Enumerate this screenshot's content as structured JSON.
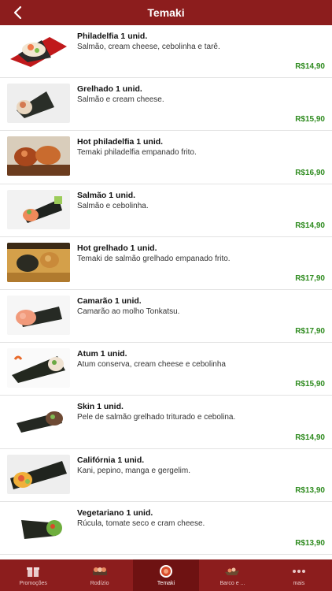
{
  "header": {
    "title": "Temaki",
    "back_icon": "chevron-left-icon"
  },
  "items": [
    {
      "name": "Philadelfia 1 unid.",
      "description": "Salmão, cream cheese, cebolinha e tarê.",
      "price": "R$14,90"
    },
    {
      "name": "Grelhado 1 unid.",
      "description": "Salmão e cream cheese.",
      "price": "R$15,90"
    },
    {
      "name": "Hot philadelfia 1 unid.",
      "description": "Temaki philadelfia empanado frito.",
      "price": "R$16,90"
    },
    {
      "name": "Salmão 1 unid.",
      "description": "Salmão e cebolinha.",
      "price": "R$14,90"
    },
    {
      "name": "Hot grelhado 1 unid.",
      "description": "Temaki de salmão grelhado empanado frito.",
      "price": "R$17,90"
    },
    {
      "name": "Camarão 1 unid.",
      "description": "Camarão ao molho Tonkatsu.",
      "price": "R$17,90"
    },
    {
      "name": "Atum 1 unid.",
      "description": "Atum conserva, cream cheese e cebolinha",
      "price": "R$15,90"
    },
    {
      "name": "Skin 1 unid.",
      "description": "Pele de salmão grelhado triturado e cebolina.",
      "price": "R$14,90"
    },
    {
      "name": "Califórnia 1 unid.",
      "description": "Kani, pepino, manga e gergelim.",
      "price": "R$13,90"
    },
    {
      "name": "Vegetariano 1 unid.",
      "description": "Rúcula, tomate seco e cram cheese.",
      "price": "R$13,90"
    }
  ],
  "tabs": [
    {
      "label": "Promoções",
      "icon": "gift-icon",
      "active": false
    },
    {
      "label": "Rodízio",
      "icon": "sushi-board-icon",
      "active": false
    },
    {
      "label": "Temaki",
      "icon": "temaki-icon",
      "active": true
    },
    {
      "label": "Barco e ...",
      "icon": "sushi-boat-icon",
      "active": false
    },
    {
      "label": "mais",
      "icon": "more-icon",
      "active": false
    }
  ],
  "colors": {
    "primary": "#8c1d1d",
    "active_tab": "#6e1212",
    "price": "#2e8b1f"
  }
}
